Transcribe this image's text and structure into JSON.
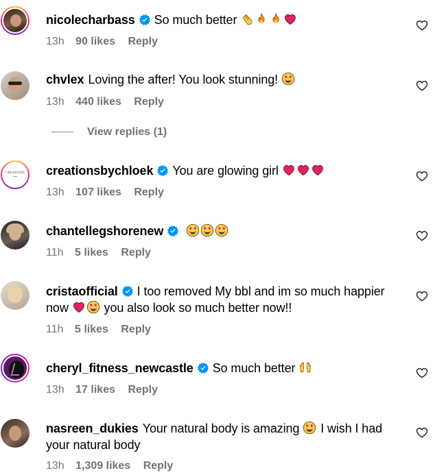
{
  "comments": [
    {
      "user": "nicolecharbass",
      "verified": true,
      "text": "So much better",
      "emojis": [
        "clap",
        "fire",
        "fire",
        "heart"
      ],
      "time": "13h",
      "likes": "90 likes",
      "reply": "Reply"
    },
    {
      "user": "chvlex",
      "verified": false,
      "text": "Loving the after! You look stunning!",
      "emojis": [
        "heart-eyes"
      ],
      "time": "13h",
      "likes": "440 likes",
      "reply": "Reply"
    },
    {
      "user": "creationsbychloek",
      "verified": true,
      "text": "You are glowing girl",
      "emojis": [
        "heart",
        "heart",
        "heart"
      ],
      "time": "13h",
      "likes": "107 likes",
      "reply": "Reply",
      "avatar_text": "CREATIONS"
    },
    {
      "user": "chantellegshorenew",
      "verified": true,
      "text": "",
      "emojis": [
        "heart-eyes",
        "heart-eyes",
        "heart-eyes"
      ],
      "time": "11h",
      "likes": "5 likes",
      "reply": "Reply"
    },
    {
      "user": "cristaofficial",
      "verified": true,
      "text": "I too removed My bbl and im so much happier now",
      "text2": "you also look so much better now!!",
      "time": "11h",
      "likes": "5 likes",
      "reply": "Reply"
    },
    {
      "user": "cheryl_fitness_newcastle",
      "verified": true,
      "text": "So much better",
      "emojis": [
        "raised-hands"
      ],
      "time": "13h",
      "likes": "17 likes",
      "reply": "Reply"
    },
    {
      "user": "nasreen_dukies",
      "verified": false,
      "text": "Your natural body is amazing",
      "text2": "I wish I had your natural body",
      "time": "13h",
      "likes": "1,309 likes",
      "reply": "Reply"
    }
  ],
  "view_replies": "View replies (1)",
  "colors": {
    "accent": "#0095f6",
    "meta": "#737373",
    "heart": "#e0245e"
  }
}
